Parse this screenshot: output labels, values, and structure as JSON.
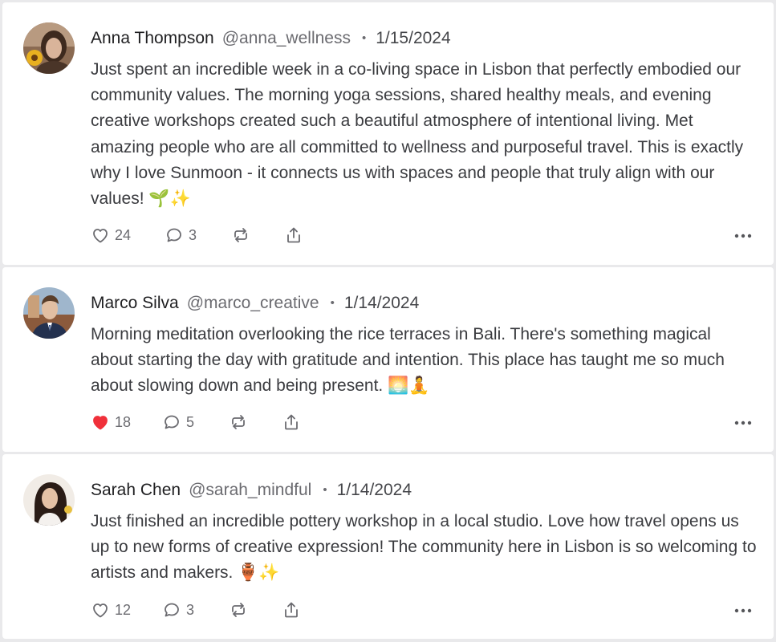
{
  "colors": {
    "liked": "#f0303a",
    "muted": "#6b6b70"
  },
  "posts": [
    {
      "name": "Anna Thompson",
      "handle": "@anna_wellness",
      "separator": "•",
      "date": "1/15/2024",
      "text": "Just spent an incredible week in a co-living space in Lisbon that perfectly embodied our community values. The morning yoga sessions, shared healthy meals, and evening creative workshops created such a beautiful atmosphere of intentional living. Met amazing people who are all committed to wellness and purposeful travel. This is exactly why I love Sunmoon - it connects us with spaces and people that truly align with our values! 🌱✨",
      "likes": "24",
      "liked": false,
      "comments": "3"
    },
    {
      "name": "Marco Silva",
      "handle": "@marco_creative",
      "separator": "•",
      "date": "1/14/2024",
      "text": "Morning meditation overlooking the rice terraces in Bali. There's something magical about starting the day with gratitude and intention. This place has taught me so much about slowing down and being present. 🌅🧘",
      "likes": "18",
      "liked": true,
      "comments": "5"
    },
    {
      "name": "Sarah Chen",
      "handle": "@sarah_mindful",
      "separator": "•",
      "date": "1/14/2024",
      "text": "Just finished an incredible pottery workshop in a local studio. Love how travel opens us up to new forms of creative expression! The community here in Lisbon is so welcoming to artists and makers. 🏺✨",
      "likes": "12",
      "liked": false,
      "comments": "3"
    }
  ]
}
